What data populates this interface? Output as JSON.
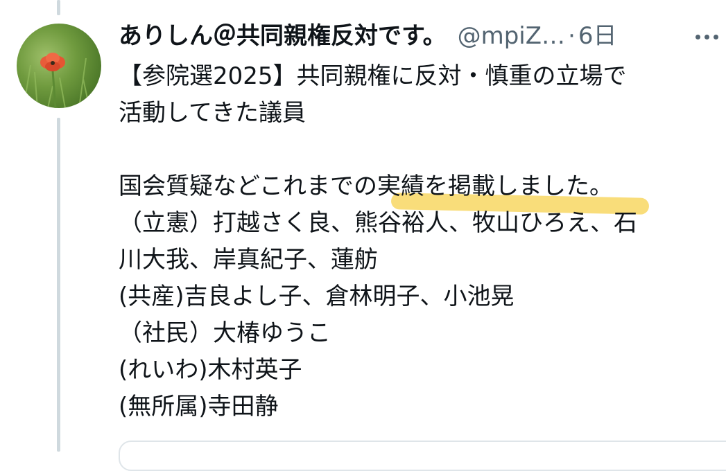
{
  "post": {
    "display_name": "ありしん＠共同親権反対です。",
    "handle": "@mpiZ…",
    "separator": "·",
    "time": "6日",
    "text_lines": [
      "【参院選2025】共同親権に反対・慎重の立場で",
      "活動してきた議員",
      "",
      "国会質疑などこれまでの実績を掲載しました。",
      "（立憲）打越さく良、熊谷裕人、牧山ひろえ、石",
      "川大我、岸真紀子、蓮舫",
      "(共産)吉良よし子、倉林明子、小池晃",
      "（社民）大椿ゆうこ",
      "(れいわ)木村英子",
      "(無所属)寺田静"
    ]
  },
  "icons": {
    "more": "more-horizontal-icon",
    "avatar": "poppy-flower-avatar"
  },
  "colors": {
    "text": "#0f1419",
    "secondary": "#536471",
    "thread_line": "#cfd9de",
    "highlight": "#f7d24d"
  }
}
